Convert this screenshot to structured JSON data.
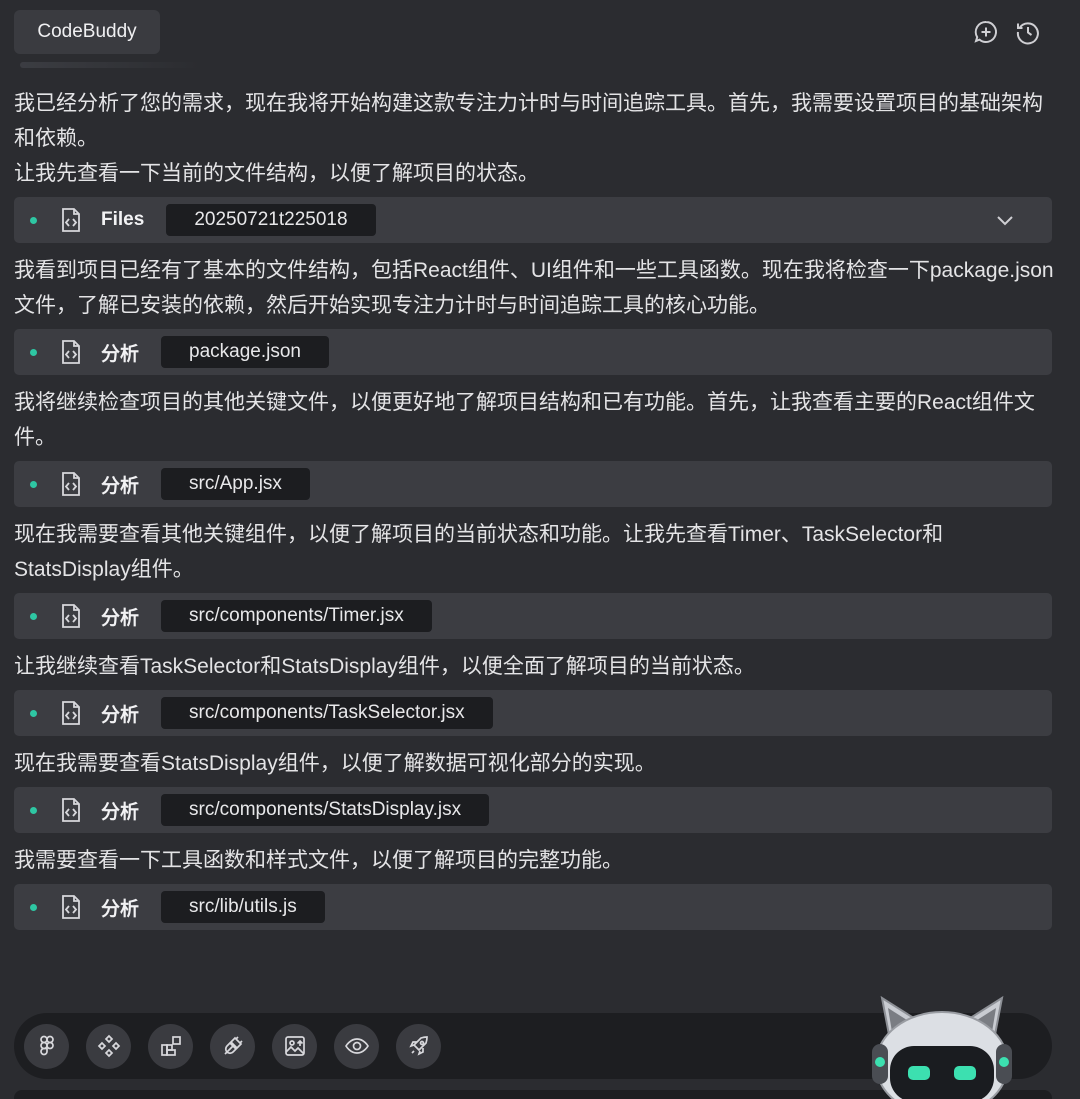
{
  "app": {
    "tab_title": "CodeBuddy"
  },
  "header": {
    "icons": [
      "new-chat-icon",
      "history-icon"
    ]
  },
  "messages": [
    {
      "text": "我已经分析了您的需求，现在我将开始构建这款专注力计时与时间追踪工具。首先，我需要设置项目的基础架构和依赖。"
    },
    {
      "text": "让我先查看一下当前的文件结构，以便了解项目的状态。"
    },
    {
      "step": {
        "label": "Files",
        "target": "20250721t225018",
        "expandable": true
      }
    },
    {
      "text": "我看到项目已经有了基本的文件结构，包括React组件、UI组件和一些工具函数。现在我将检查一下package.json文件，了解已安装的依赖，然后开始实现专注力计时与时间追踪工具的核心功能。"
    },
    {
      "step": {
        "label": "分析",
        "target": "package.json"
      }
    },
    {
      "text": "我将继续检查项目的其他关键文件，以便更好地了解项目结构和已有功能。首先，让我查看主要的React组件文件。"
    },
    {
      "step": {
        "label": "分析",
        "target": "src/App.jsx"
      }
    },
    {
      "text": "现在我需要查看其他关键组件，以便了解项目的当前状态和功能。让我先查看Timer、TaskSelector和StatsDisplay组件。"
    },
    {
      "step": {
        "label": "分析",
        "target": "src/components/Timer.jsx"
      }
    },
    {
      "text": "让我继续查看TaskSelector和StatsDisplay组件，以便全面了解项目的当前状态。"
    },
    {
      "step": {
        "label": "分析",
        "target": "src/components/TaskSelector.jsx"
      }
    },
    {
      "text": "现在我需要查看StatsDisplay组件，以便了解数据可视化部分的实现。"
    },
    {
      "step": {
        "label": "分析",
        "target": "src/components/StatsDisplay.jsx"
      }
    },
    {
      "text": "我需要查看一下工具函数和样式文件，以便了解项目的完整功能。"
    },
    {
      "step": {
        "label": "分析",
        "target": "src/lib/utils.js"
      }
    }
  ],
  "toolbar": {
    "tools": [
      {
        "name": "figma-icon"
      },
      {
        "name": "component-icon"
      },
      {
        "name": "blocks-icon"
      },
      {
        "name": "plug-icon"
      },
      {
        "name": "image-upload-icon"
      },
      {
        "name": "preview-eye-icon"
      },
      {
        "name": "deploy-rocket-icon"
      }
    ]
  },
  "colors": {
    "accent": "#2ec7a3",
    "background": "#2b2c30",
    "step_bg": "#3c3d42",
    "chip_bg": "#1c1d20"
  }
}
